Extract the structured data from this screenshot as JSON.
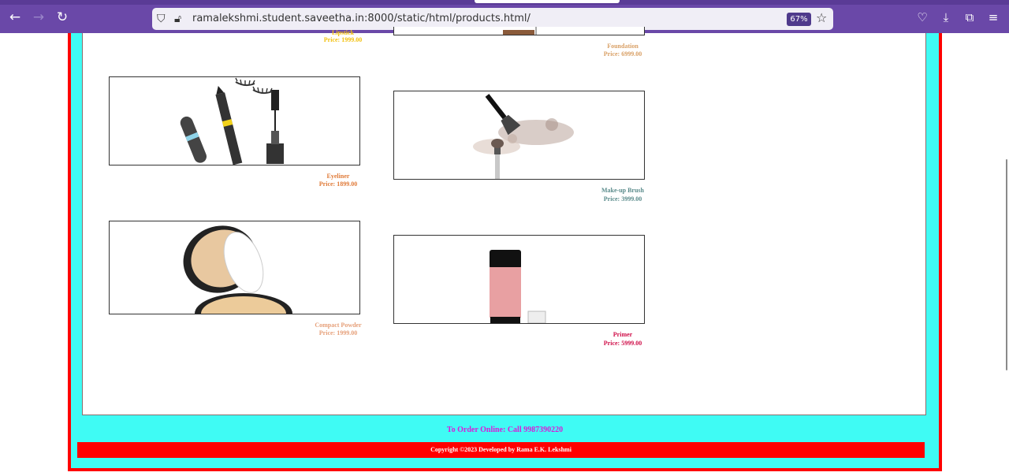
{
  "browser": {
    "url": "ramalekshmi.student.saveetha.in:8000/static/html/products.html/",
    "zoom": "67%"
  },
  "products": [
    {
      "name": "Lipstick",
      "price": "Price: 1999.00",
      "color": "#f2c10f"
    },
    {
      "name": "Foundation",
      "price": "Price: 6999.00",
      "color": "#d9a066"
    },
    {
      "name": "Eyeliner",
      "price": "Price: 1899.00",
      "color": "#e07b39"
    },
    {
      "name": "Make-up Brush",
      "price": "Price: 3999.00",
      "color": "#5b8c8c"
    },
    {
      "name": "Compact Powder",
      "price": "Price: 1999.00",
      "color": "#e6a07a"
    },
    {
      "name": "Primer",
      "price": "Price: 5999.00",
      "color": "#d0104a"
    }
  ],
  "footer": {
    "order_text": "To Order Online: Call 9987390220",
    "copyright": "Copyright ©2023 Developed by Rama E.K. Lekshmi"
  },
  "colors": {
    "frame": "#ff0000",
    "footer_bg": "#3ffbf4",
    "order_text": "#d81bd8"
  }
}
